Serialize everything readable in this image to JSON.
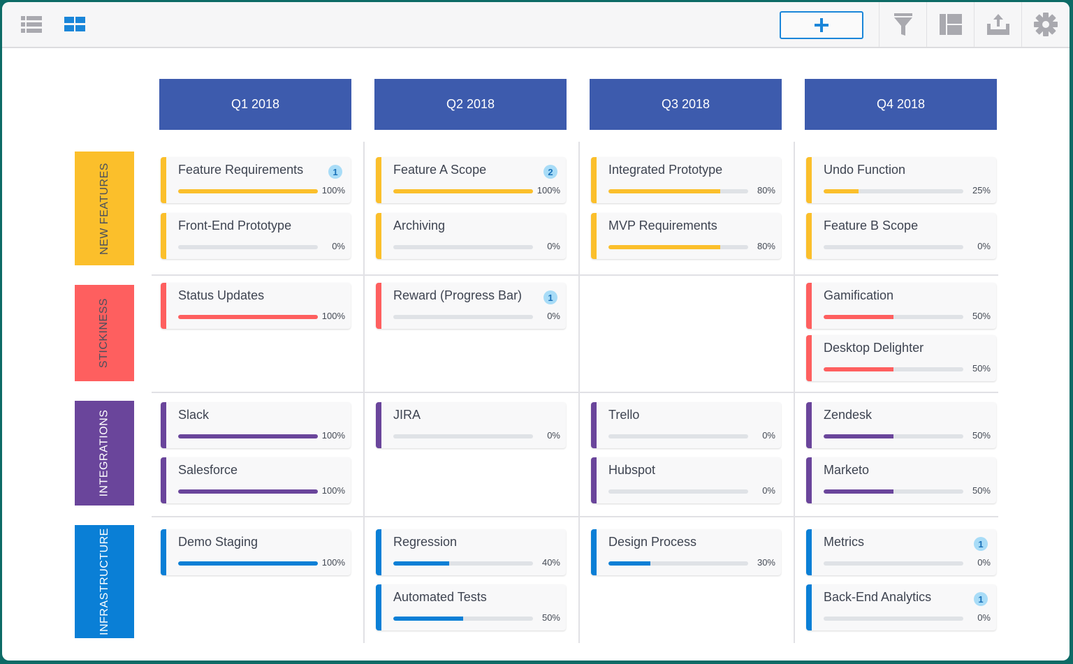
{
  "toolbar": {
    "left_icons": [
      {
        "name": "list-view-icon",
        "active": false
      },
      {
        "name": "grid-view-icon",
        "active": true
      }
    ],
    "add_button": {
      "icon": "plus-icon",
      "label": "+"
    },
    "right_icons": [
      "filter-icon",
      "layout-icon",
      "export-icon",
      "settings-icon"
    ],
    "colors": {
      "active": "#1a86d9",
      "inactive": "#a9a9af"
    }
  },
  "columns": [
    "Q1 2018",
    "Q2 2018",
    "Q3 2018",
    "Q4 2018"
  ],
  "rows": [
    {
      "label": "NEW FEATURES",
      "color": "#fbbf2b",
      "text_color": "#4a4f5c"
    },
    {
      "label": "STICKINESS",
      "color": "#fe5f5f",
      "text_color": "#4a4f5c"
    },
    {
      "label": "INTEGRATIONS",
      "color": "#6a459b",
      "text_color": "#ffffff"
    },
    {
      "label": "INFRASTRUCTURE",
      "color": "#0a7fd6",
      "text_color": "#ffffff"
    }
  ],
  "cards": [
    {
      "row": 0,
      "col": 0,
      "slot": 0,
      "title": "Feature Requirements",
      "progress": 100,
      "pct": "100%",
      "badge": "1"
    },
    {
      "row": 0,
      "col": 0,
      "slot": 1,
      "title": "Front-End Prototype",
      "progress": 0,
      "pct": "0%"
    },
    {
      "row": 0,
      "col": 1,
      "slot": 0,
      "title": "Feature A Scope",
      "progress": 100,
      "pct": "100%",
      "badge": "2"
    },
    {
      "row": 0,
      "col": 1,
      "slot": 1,
      "title": "Archiving",
      "progress": 0,
      "pct": "0%"
    },
    {
      "row": 0,
      "col": 2,
      "slot": 0,
      "title": "Integrated Prototype",
      "progress": 80,
      "pct": "80%"
    },
    {
      "row": 0,
      "col": 2,
      "slot": 1,
      "title": "MVP Requirements",
      "progress": 80,
      "pct": "80%"
    },
    {
      "row": 0,
      "col": 3,
      "slot": 0,
      "title": "Undo Function",
      "progress": 25,
      "pct": "25%"
    },
    {
      "row": 0,
      "col": 3,
      "slot": 1,
      "title": "Feature B Scope",
      "progress": 0,
      "pct": "0%"
    },
    {
      "row": 1,
      "col": 0,
      "slot": 0,
      "title": "Status Updates",
      "progress": 100,
      "pct": "100%"
    },
    {
      "row": 1,
      "col": 1,
      "slot": 0,
      "title": "Reward (Progress Bar)",
      "progress": 0,
      "pct": "0%",
      "badge": "1"
    },
    {
      "row": 1,
      "col": 3,
      "slot": 0,
      "title": "Gamification",
      "progress": 50,
      "pct": "50%"
    },
    {
      "row": 1,
      "col": 3,
      "slot": 1,
      "title": "Desktop Delighter",
      "progress": 50,
      "pct": "50%"
    },
    {
      "row": 2,
      "col": 0,
      "slot": 0,
      "title": "Slack",
      "progress": 100,
      "pct": "100%"
    },
    {
      "row": 2,
      "col": 0,
      "slot": 1,
      "title": "Salesforce",
      "progress": 100,
      "pct": "100%"
    },
    {
      "row": 2,
      "col": 1,
      "slot": 0,
      "title": "JIRA",
      "progress": 0,
      "pct": "0%"
    },
    {
      "row": 2,
      "col": 2,
      "slot": 0,
      "title": "Trello",
      "progress": 0,
      "pct": "0%"
    },
    {
      "row": 2,
      "col": 2,
      "slot": 1,
      "title": "Hubspot",
      "progress": 0,
      "pct": "0%"
    },
    {
      "row": 2,
      "col": 3,
      "slot": 0,
      "title": "Zendesk",
      "progress": 50,
      "pct": "50%"
    },
    {
      "row": 2,
      "col": 3,
      "slot": 1,
      "title": "Marketo",
      "progress": 50,
      "pct": "50%"
    },
    {
      "row": 3,
      "col": 0,
      "slot": 0,
      "title": "Demo Staging",
      "progress": 100,
      "pct": "100%"
    },
    {
      "row": 3,
      "col": 1,
      "slot": 0,
      "title": "Regression",
      "progress": 40,
      "pct": "40%"
    },
    {
      "row": 3,
      "col": 1,
      "slot": 1,
      "title": "Automated Tests",
      "progress": 50,
      "pct": "50%"
    },
    {
      "row": 3,
      "col": 2,
      "slot": 0,
      "title": "Design Process",
      "progress": 30,
      "pct": "30%"
    },
    {
      "row": 3,
      "col": 3,
      "slot": 0,
      "title": "Metrics",
      "progress": 0,
      "pct": "0%",
      "badge": "1"
    },
    {
      "row": 3,
      "col": 3,
      "slot": 1,
      "title": "Back-End Analytics",
      "progress": 0,
      "pct": "0%",
      "badge": "1"
    }
  ]
}
